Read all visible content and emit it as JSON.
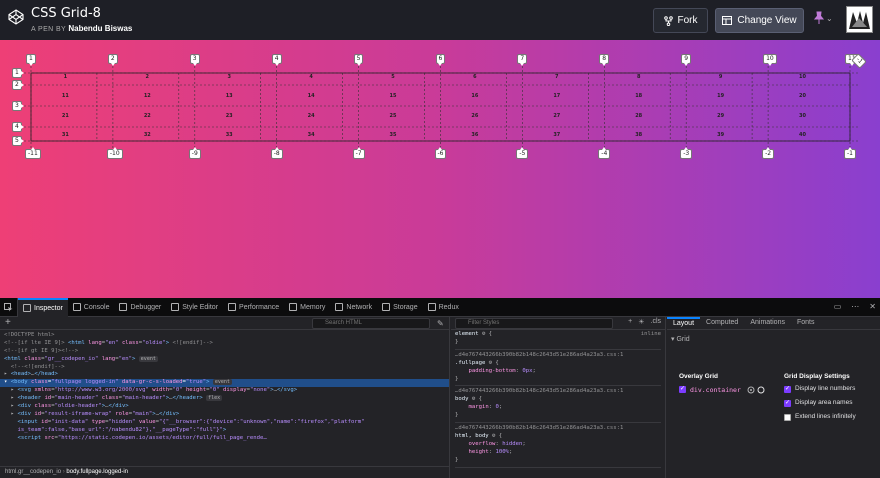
{
  "header": {
    "title": "CSS Grid-8",
    "author_prefix": "A PEN BY",
    "author": "Nabendu Biswas",
    "fork_label": "Fork",
    "change_view_label": "Change View"
  },
  "grid": {
    "column_top_labels": [
      "1",
      "2",
      "3",
      "4",
      "5",
      "6",
      "7",
      "8",
      "9",
      "10",
      "11"
    ],
    "column_bottom_labels": [
      "-11",
      "-10",
      "-9",
      "-8",
      "-7",
      "-6",
      "-5",
      "-4",
      "-3",
      "-2",
      "-1"
    ],
    "row_labels": [
      "1",
      "2",
      "3",
      "4",
      "5"
    ],
    "corner_label": "-1",
    "cells": [
      [
        "1",
        "2",
        "3",
        "4",
        "5",
        "6",
        "7",
        "8",
        "9",
        "10"
      ],
      [
        "11",
        "12",
        "13",
        "14",
        "15",
        "16",
        "17",
        "18",
        "19",
        "20"
      ],
      [
        "21",
        "22",
        "23",
        "24",
        "25",
        "26",
        "27",
        "28",
        "29",
        "30"
      ],
      [
        "31",
        "32",
        "33",
        "34",
        "35",
        "36",
        "37",
        "38",
        "39",
        "40"
      ]
    ]
  },
  "devtools": {
    "tabs": [
      "Inspector",
      "Console",
      "Debugger",
      "Style Editor",
      "Performance",
      "Memory",
      "Network",
      "Storage",
      "Redux"
    ],
    "active_tab": "Inspector",
    "search_placeholder": "Search HTML",
    "markup_lines": [
      {
        "html": "<span class=\"c-comment\">&lt;!DOCTYPE html&gt;</span>"
      },
      {
        "html": "<span class=\"c-comment\">&lt;!--[if lte IE 9]&gt;</span> <span class=\"c-tag\">&lt;html</span> <span class=\"c-attr\">lang</span>=<span class=\"c-val\">\"en\"</span> <span class=\"c-attr\">class</span>=<span class=\"c-val\">\"oldie\"</span><span class=\"c-tag\">&gt;</span> <span class=\"c-comment\">&lt;![endif]--&gt;</span>"
      },
      {
        "html": "<span class=\"c-comment\">&lt;!--[if gt IE 9]&gt;&lt;!--&gt;</span>"
      },
      {
        "html": "<span class=\"c-tag\">&lt;html</span> <span class=\"c-attr\">class</span>=<span class=\"c-val\">\"gr__codepen_io\"</span> <span class=\"c-attr\">lang</span>=<span class=\"c-val\">\"en\"</span><span class=\"c-tag\">&gt;</span> <span class=\"c-ev\">event</span>"
      },
      {
        "html": "  <span class=\"c-comment\">&lt;!--&lt;![endif]--&gt;</span>"
      },
      {
        "html": "▸ <span class=\"c-tag\">&lt;head&gt;</span>…<span class=\"c-tag\">&lt;/head&gt;</span>"
      },
      {
        "html": "▾ <span class=\"c-tag\">&lt;body</span> <span class=\"c-attr\">class</span>=<span class=\"c-val\">\"fullpage logged-in\"</span> <span class=\"c-attr\">data-gr-c-s-loaded</span>=<span class=\"c-val\">\"true\"</span><span class=\"c-tag\">&gt;</span> <span class=\"c-ev\">event</span>",
        "selected": true
      },
      {
        "html": "  ▸ <span class=\"c-tag\">&lt;svg</span> <span class=\"c-attr\">xmlns</span>=<span class=\"c-val\">\"http://www.w3.org/2000/svg\"</span> <span class=\"c-attr\">width</span>=<span class=\"c-val\">\"0\"</span> <span class=\"c-attr\">height</span>=<span class=\"c-val\">\"0\"</span> <span class=\"c-attr\">display</span>=<span class=\"c-val\">\"none\"</span><span class=\"c-tag\">&gt;</span>…<span class=\"c-tag\">&lt;/svg&gt;</span>"
      },
      {
        "html": "  ▸ <span class=\"c-tag\">&lt;header</span> <span class=\"c-attr\">id</span>=<span class=\"c-val\">\"main-header\"</span> <span class=\"c-attr\">class</span>=<span class=\"c-val\">\"main-header\"</span><span class=\"c-tag\">&gt;</span>…<span class=\"c-tag\">&lt;/header&gt;</span> <span class=\"c-ev\">flex</span>"
      },
      {
        "html": "  ▸ <span class=\"c-tag\">&lt;div</span> <span class=\"c-attr\">class</span>=<span class=\"c-val\">\"oldie-header\"</span><span class=\"c-tag\">&gt;</span>…<span class=\"c-tag\">&lt;/div&gt;</span>"
      },
      {
        "html": "  ▸ <span class=\"c-tag\">&lt;div</span> <span class=\"c-attr\">id</span>=<span class=\"c-val\">\"result-iframe-wrap\"</span> <span class=\"c-attr\">role</span>=<span class=\"c-val\">\"main\"</span><span class=\"c-tag\">&gt;</span>…<span class=\"c-tag\">&lt;/div&gt;</span>"
      },
      {
        "html": "    <span class=\"c-tag\">&lt;input</span> <span class=\"c-attr\">id</span>=<span class=\"c-val\">\"init-data\"</span> <span class=\"c-attr\">type</span>=<span class=\"c-val\">\"hidden\"</span> <span class=\"c-attr\">value</span>=<span class=\"c-val\">\"{\"__browser\":{\"device\":\"unknown\",\"name\":\"firefox\",\"platform\"</span>"
      },
      {
        "html": "    <span class=\"c-val\">is_team\":false,\"base_url\":\"/nabendu82\"},\"__pageType\":\"full\"}\"</span><span class=\"c-tag\">&gt;</span>"
      },
      {
        "html": "    <span class=\"c-tag\">&lt;script</span> <span class=\"c-attr\">src</span>=<span class=\"c-val\">\"https://static.codepen.io/assets/editor/full/full_page_rende…</span>"
      }
    ],
    "breadcrumb": [
      "html.gr__codepen_io",
      "body.fullpage.logged-in"
    ],
    "filter_placeholder": "Filter Styles",
    "rules_tools": [
      "+",
      "☀",
      ".cls"
    ],
    "rules": [
      {
        "source": "",
        "selector": "element",
        "props": [],
        "inline": "inline"
      },
      {
        "source": "…d4e767443266b390b82b148c2643d51e286ad4a23a3.css:1",
        "selector": ".fullpage",
        "props": [
          [
            "padding-bottom",
            "0px"
          ]
        ]
      },
      {
        "source": "…d4e767443266b390b82b148c2643d51e286ad4a23a3.css:1",
        "selector": "body",
        "props": [
          [
            "margin",
            "0"
          ]
        ]
      },
      {
        "source": "…d4e767443266b390b82b148c2643d51e286ad4a23a3.css:1",
        "selector": "html, body",
        "props": [
          [
            "overflow",
            "hidden"
          ],
          [
            "height",
            "100%"
          ]
        ]
      }
    ],
    "layout_tabs": [
      "Layout",
      "Computed",
      "Animations",
      "Fonts"
    ],
    "layout_active": "Layout",
    "layout": {
      "section": "Grid",
      "overlay_title": "Overlay Grid",
      "container": "div.container",
      "settings_title": "Grid Display Settings",
      "settings": [
        {
          "label": "Display line numbers",
          "checked": true
        },
        {
          "label": "Display area names",
          "checked": true
        },
        {
          "label": "Extend lines infinitely",
          "checked": false
        }
      ]
    }
  }
}
